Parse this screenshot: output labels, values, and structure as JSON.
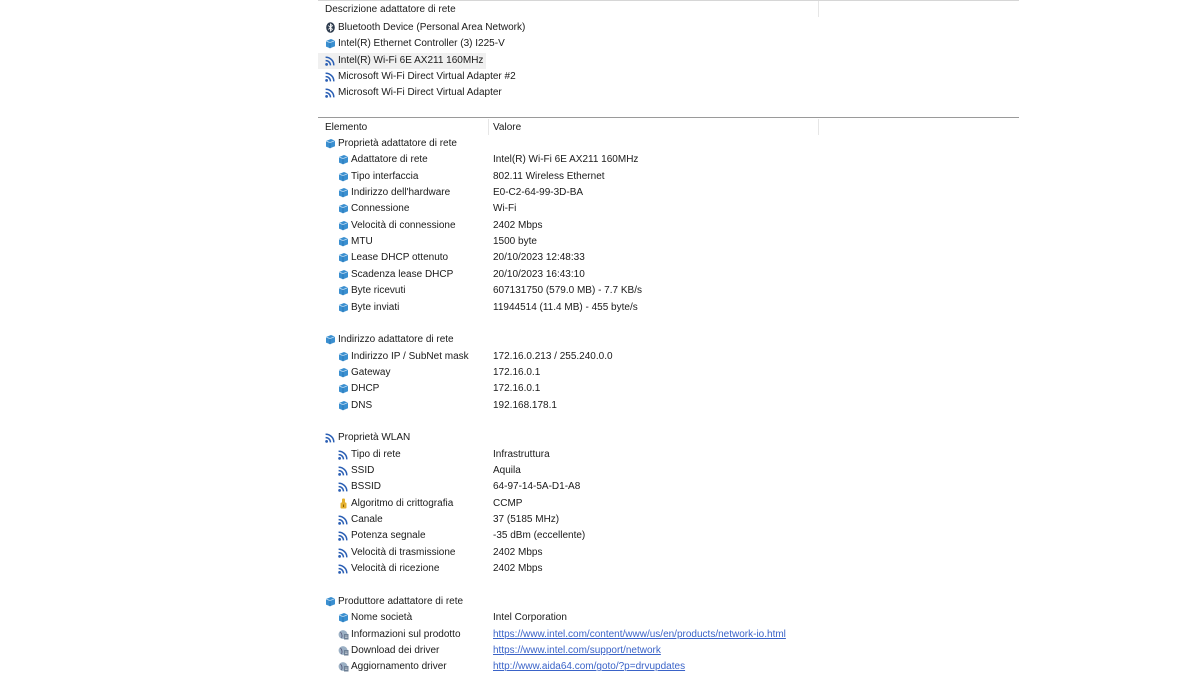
{
  "adapters_panel": {
    "header": "Descrizione adattatore di rete",
    "items": [
      {
        "icon": "bluetooth-icon",
        "label": "Bluetooth Device (Personal Area Network)"
      },
      {
        "icon": "ethernet-adapter-icon",
        "label": "Intel(R) Ethernet Controller (3) I225-V"
      },
      {
        "icon": "wifi-icon",
        "label": "Intel(R) Wi-Fi 6E AX211 160MHz",
        "selected": true
      },
      {
        "icon": "wifi-icon",
        "label": "Microsoft Wi-Fi Direct Virtual Adapter #2"
      },
      {
        "icon": "wifi-icon",
        "label": "Microsoft Wi-Fi Direct Virtual Adapter"
      }
    ]
  },
  "details_panel": {
    "col_element": "Elemento",
    "col_value": "Valore",
    "groups": [
      {
        "title": "Proprietà adattatore di rete",
        "icon": "network-adapter-icon",
        "rows": [
          {
            "icon": "network-adapter-icon",
            "label": "Adattatore di rete",
            "value": "Intel(R) Wi-Fi 6E AX211 160MHz"
          },
          {
            "icon": "network-adapter-icon",
            "label": "Tipo interfaccia",
            "value": "802.11 Wireless Ethernet"
          },
          {
            "icon": "network-adapter-icon",
            "label": "Indirizzo dell'hardware",
            "value": "E0-C2-64-99-3D-BA"
          },
          {
            "icon": "network-adapter-icon",
            "label": "Connessione",
            "value": "Wi-Fi"
          },
          {
            "icon": "network-adapter-icon",
            "label": "Velocità di connessione",
            "value": "2402 Mbps"
          },
          {
            "icon": "network-adapter-icon",
            "label": "MTU",
            "value": "1500 byte"
          },
          {
            "icon": "network-adapter-icon",
            "label": "Lease DHCP ottenuto",
            "value": "20/10/2023 12:48:33"
          },
          {
            "icon": "network-adapter-icon",
            "label": "Scadenza lease DHCP",
            "value": "20/10/2023 16:43:10"
          },
          {
            "icon": "network-adapter-icon",
            "label": "Byte ricevuti",
            "value": "607131750 (579.0 MB) - 7.7 KB/s"
          },
          {
            "icon": "network-adapter-icon",
            "label": "Byte inviati",
            "value": "11944514 (11.4 MB) - 455 byte/s"
          }
        ]
      },
      {
        "title": "Indirizzo adattatore di rete",
        "icon": "network-adapter-icon",
        "rows": [
          {
            "icon": "network-adapter-icon",
            "label": "Indirizzo IP / SubNet mask",
            "value": "172.16.0.213 / 255.240.0.0"
          },
          {
            "icon": "network-adapter-icon",
            "label": "Gateway",
            "value": "172.16.0.1"
          },
          {
            "icon": "network-adapter-icon",
            "label": "DHCP",
            "value": "172.16.0.1"
          },
          {
            "icon": "network-adapter-icon",
            "label": "DNS",
            "value": "192.168.178.1"
          }
        ]
      },
      {
        "title": "Proprietà WLAN",
        "icon": "wifi-icon",
        "rows": [
          {
            "icon": "wifi-icon",
            "label": "Tipo di rete",
            "value": "Infrastruttura"
          },
          {
            "icon": "wifi-icon",
            "label": "SSID",
            "value": "Aquila"
          },
          {
            "icon": "wifi-icon",
            "label": "BSSID",
            "value": "64-97-14-5A-D1-A8"
          },
          {
            "icon": "encryption-key-icon",
            "label": "Algoritmo di crittografia",
            "value": "CCMP"
          },
          {
            "icon": "wifi-icon",
            "label": "Canale",
            "value": "37 (5185 MHz)"
          },
          {
            "icon": "wifi-icon",
            "label": "Potenza segnale",
            "value": "-35 dBm (eccellente)"
          },
          {
            "icon": "wifi-icon",
            "label": "Velocità di trasmissione",
            "value": "2402 Mbps"
          },
          {
            "icon": "wifi-icon",
            "label": "Velocità di ricezione",
            "value": "2402 Mbps"
          }
        ]
      },
      {
        "title": "Produttore adattatore di rete",
        "icon": "network-adapter-icon",
        "rows": [
          {
            "icon": "network-adapter-icon",
            "label": "Nome società",
            "value": "Intel Corporation"
          },
          {
            "icon": "info-link-icon",
            "label": "Informazioni sul prodotto",
            "value": "https://www.intel.com/content/www/us/en/products/network-io.html",
            "link": true
          },
          {
            "icon": "download-link-icon",
            "label": "Download dei driver",
            "value": "https://www.intel.com/support/network",
            "link": true
          },
          {
            "icon": "update-link-icon",
            "label": "Aggiornamento driver",
            "value": "http://www.aida64.com/goto/?p=drvupdates",
            "link": true
          }
        ]
      }
    ]
  },
  "colors": {
    "adapter_icon": "#3a8fd0",
    "wifi_icon": "#2b5fb4",
    "link": "#3a63c8",
    "key_icon": "#e3b02f"
  }
}
